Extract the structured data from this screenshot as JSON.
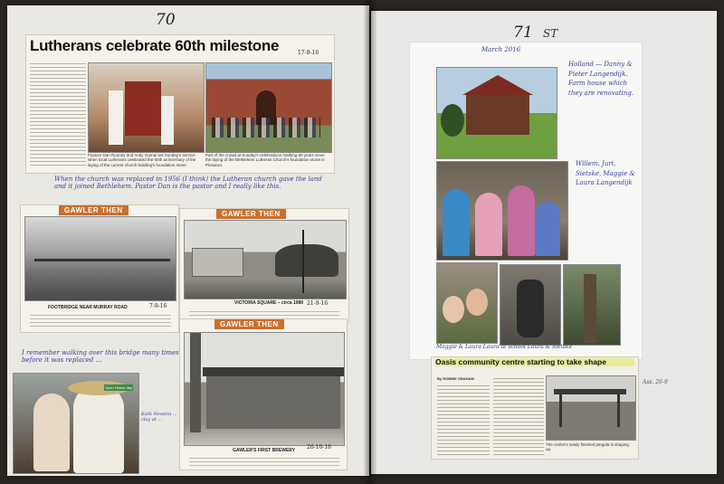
{
  "left_page": {
    "page_number": "70",
    "headline": "Lutherans celebrate 60th milestone",
    "headline_date": "17-9-16",
    "photo_caption_1": "Pastors Dan Rooney and Andy Garnai led Sunday's service when local Lutherans celebrated the 60th anniversary of the laying of the current church building's foundation stone.",
    "photo_caption_2": "Part of the crowd at Sunday's celebrations marking 60 years since the laying of the Bethlehem Lutheran Church's foundation stone in Pinnaroo.",
    "handwritten_note": "When the church was replaced in 1956 (I think) the Lutheran church gave the land and it joined Bethlehem. Pastor Dan is the pastor and I really like this.",
    "gawler_then_1": {
      "header": "GAWLER THEN",
      "caption_title": "FOOTBRIDGE NEAR MURRAY ROAD",
      "date": "7-9-16"
    },
    "gawler_then_2": {
      "header": "GAWLER THEN",
      "caption_title": "VICTORIA SQUARE – circa 1980",
      "date": "21-9-16"
    },
    "gawler_then_3": {
      "header": "GAWLER THEN",
      "caption_title": "GAWLER'S FIRST BREWERY",
      "date": "26-10-16",
      "mark": "✕"
    },
    "handwritten_note_2": "I remember walking over this bridge many times before it was replaced ...",
    "side_note": "Kath Newton ... clay at ...",
    "costume_photo_label": "Open House day"
  },
  "right_page": {
    "page_number": "71",
    "corner_mark": "ST",
    "month_note": "March 2016",
    "holland_note": "Holland — Danny & Pieter Langendijk. Farm house which they are renovating.",
    "grandkids_note": "Willem, Juri, Sietske, Maggie & Laura Langendijk",
    "grandkids_caption": "Maggie & Laura   Laura at school   Laura & Sietske",
    "oasis_headline": "Oasis community centre starting to take shape",
    "oasis_byline": "By ROBBIE GRAHAM",
    "oasis_caption": "The centre's newly finished pergola is shaping up.",
    "oasis_date": "Ass. 26-9"
  }
}
